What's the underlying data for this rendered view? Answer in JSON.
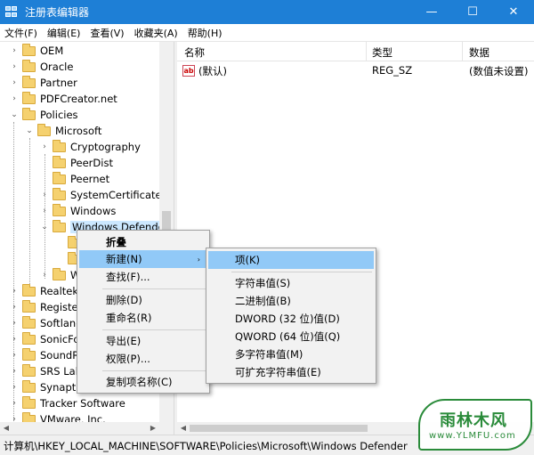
{
  "window": {
    "title": "注册表编辑器",
    "minimize_glyph": "—",
    "maximize_glyph": "☐",
    "close_glyph": "✕"
  },
  "menubar": [
    "文件(F)",
    "编辑(E)",
    "查看(V)",
    "收藏夹(A)",
    "帮助(H)"
  ],
  "tree": {
    "items": [
      {
        "label": "OEM",
        "expander": "›"
      },
      {
        "label": "Oracle",
        "expander": "›"
      },
      {
        "label": "Partner",
        "expander": "›"
      },
      {
        "label": "PDFCreator.net",
        "expander": "›"
      },
      {
        "label": "Policies",
        "expander": "⌄"
      },
      {
        "label": "Microsoft",
        "expander": "⌄"
      },
      {
        "label": "Cryptography",
        "expander": "›"
      },
      {
        "label": "PeerDist",
        "expander": ""
      },
      {
        "label": "Peernet",
        "expander": ""
      },
      {
        "label": "SystemCertificates",
        "expander": "›"
      },
      {
        "label": "Windows",
        "expander": "›"
      },
      {
        "label": "Windows Defender",
        "expander": "⌄"
      },
      {
        "label": "",
        "expander": ""
      },
      {
        "label": "",
        "expander": ""
      },
      {
        "label": "W",
        "expander": "›"
      },
      {
        "label": "Realtek",
        "expander": "›"
      },
      {
        "label": "Register",
        "expander": "›"
      },
      {
        "label": "Softland",
        "expander": "›"
      },
      {
        "label": "SonicFoc",
        "expander": "›"
      },
      {
        "label": "SoundRe",
        "expander": "›"
      },
      {
        "label": "SRS Labs",
        "expander": "›"
      },
      {
        "label": "Synaptic",
        "expander": "›"
      },
      {
        "label": "Tracker Software",
        "expander": "›"
      },
      {
        "label": "VMware, Inc.",
        "expander": "›"
      }
    ]
  },
  "list": {
    "columns": [
      "名称",
      "类型",
      "数据"
    ],
    "rows": [
      {
        "icon": "ab",
        "name": "(默认)",
        "type": "REG_SZ",
        "data": "(数值未设置)"
      }
    ]
  },
  "statusbar": {
    "path": "计算机\\HKEY_LOCAL_MACHINE\\SOFTWARE\\Policies\\Microsoft\\Windows Defender"
  },
  "context_menu": {
    "items": [
      "折叠",
      "新建(N)",
      "查找(F)...",
      "删除(D)",
      "重命名(R)",
      "导出(E)",
      "权限(P)...",
      "复制项名称(C)"
    ],
    "submenu_arrow": "›"
  },
  "submenu": {
    "items": [
      "项(K)",
      "字符串值(S)",
      "二进制值(B)",
      "DWORD (32 位)值(D)",
      "QWORD (64 位)值(Q)",
      "多字符串值(M)",
      "可扩充字符串值(E)"
    ]
  },
  "watermark": {
    "text": "雨林木风",
    "url": "www.YLMFU.com"
  },
  "colors": {
    "titlebar": "#1e7fd6",
    "menu_highlight": "#91c9f7",
    "folder": "#f5d16f",
    "watermark": "#2a8b3a"
  }
}
